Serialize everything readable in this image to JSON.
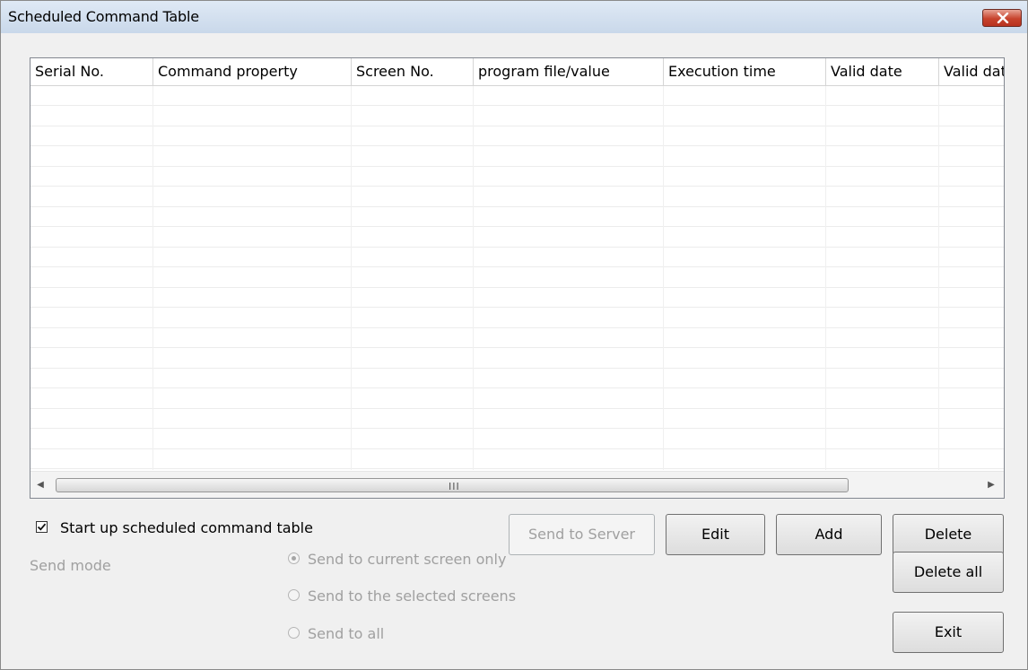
{
  "window": {
    "title": "Scheduled Command Table"
  },
  "table": {
    "columns": [
      "Serial No.",
      "Command property",
      "Screen No.",
      "program file/value",
      "Execution time",
      "Valid date",
      "Valid date"
    ],
    "rows": []
  },
  "options": {
    "startup_label": "Start up scheduled command table",
    "startup_checked": true
  },
  "buttons": {
    "send_to_server": "Send to Server",
    "edit": "Edit",
    "add": "Add",
    "delete": "Delete",
    "delete_all": "Delete all",
    "exit": "Exit"
  },
  "send_mode": {
    "label": "Send mode",
    "options": [
      "Send to current screen only",
      "Send to the selected screens",
      "Send to all"
    ],
    "selected_index": 0,
    "enabled": false
  },
  "scrollbar": {
    "grip": "III"
  }
}
